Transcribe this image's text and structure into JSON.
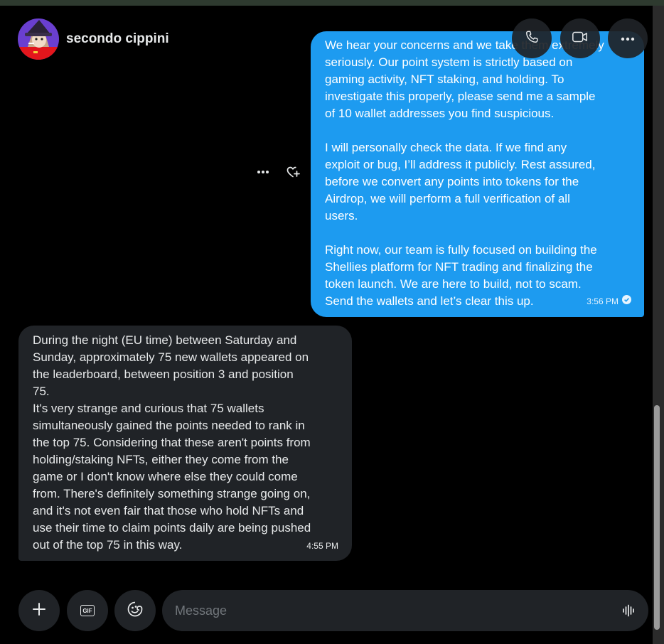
{
  "contact": {
    "name": "secondo cippini"
  },
  "header_icons": [
    "phone-icon",
    "video-icon",
    "more-icon"
  ],
  "messages": {
    "sent": {
      "lines": [
        "We hear your concerns and we take them extremely",
        "seriously. Our point system is strictly based on",
        "gaming activity, NFT staking, and holding. To",
        "investigate this properly, please send me a sample",
        "of 10 wallet addresses you find suspicious.",
        "",
        "I will personally check the data. If we find any",
        "exploit or bug, I’ll address it publicly. Rest assured,",
        "before we convert any points into tokens for the",
        "Airdrop, we will perform a full verification of all",
        "users.",
        "",
        "Right now, our team is fully focused on building the",
        "Shellies platform for NFT trading and finalizing the",
        "token launch. We are here to build, not to scam.",
        "Send the wallets and let’s clear this up."
      ],
      "time": "3:56 PM"
    },
    "received": {
      "lines": [
        "During the night (EU time) between Saturday and",
        "Sunday, approximately 75 new wallets appeared on",
        "the leaderboard, between position 3 and position",
        "75.",
        "It's very strange and curious that 75 wallets",
        "simultaneously gained the points needed to rank in",
        "the top 75. Considering that these aren't points from",
        "holding/staking NFTs, either they come from the",
        "game or I don't know where else they could come",
        "from. There's definitely something strange going on,",
        "and it's not even fair that those who hold NFTs and",
        "use their time to claim points daily are being pushed",
        "out of the top 75 in this way."
      ],
      "time": "4:55 PM"
    }
  },
  "composer": {
    "placeholder": "Message",
    "gif_label": "GIF"
  },
  "colors": {
    "accent": "#1d9bf0",
    "bubble_received": "#202327",
    "background": "#000000"
  }
}
